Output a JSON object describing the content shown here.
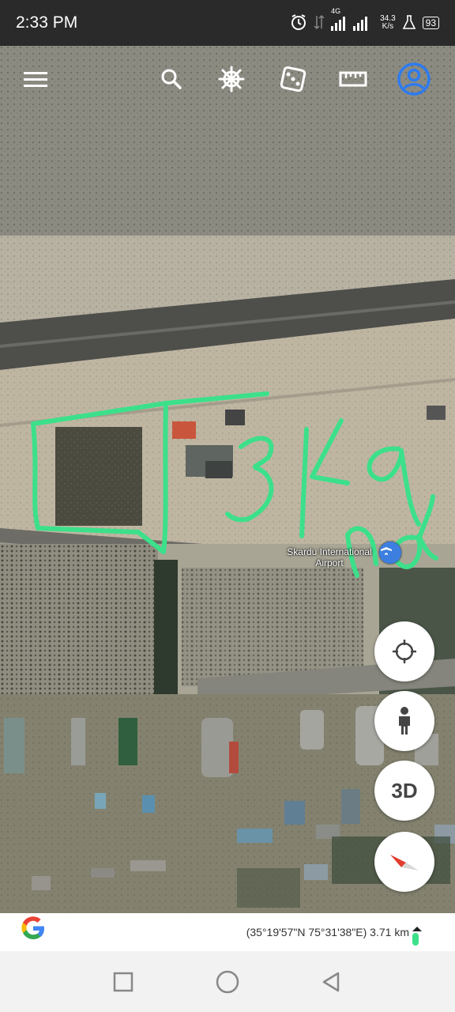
{
  "status_bar": {
    "time": "2:33 PM",
    "network_type": "4G",
    "net_speed_value": "34.3",
    "net_speed_unit": "K/s",
    "battery": "93"
  },
  "toolbar": {
    "icons": [
      "menu-icon",
      "search-icon",
      "ships-wheel-icon",
      "dice-icon",
      "ruler-icon",
      "account-icon"
    ]
  },
  "map": {
    "place_label": "Skardu International Airport",
    "place_label_line1": "Skardu International",
    "place_label_line2": "Airport",
    "annotation_text": "3Kanal",
    "colors": {
      "annotation": "#3ce08a",
      "pin": "#3d7fe0",
      "runway": "#4e4e4b"
    }
  },
  "fabs": {
    "locate_icon": "crosshair-icon",
    "streetview_icon": "pegman-icon",
    "three_d_label": "3D",
    "compass_icon": "compass-icon"
  },
  "info_bar": {
    "logo": "G",
    "coordinates": "(35°19'57\"N 75°31'38\"E) 3.71 km"
  },
  "nav_bar": {
    "icons": [
      "recents-square-icon",
      "home-circle-icon",
      "back-triangle-icon"
    ]
  }
}
